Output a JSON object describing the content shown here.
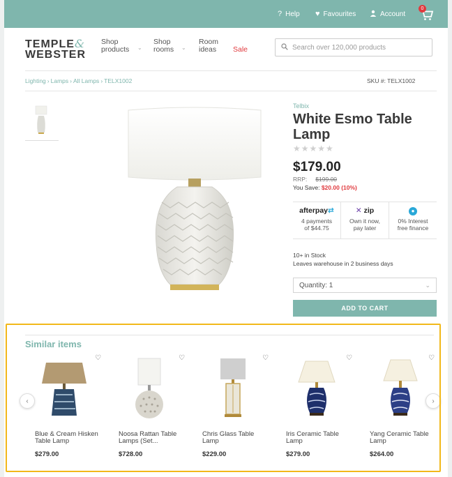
{
  "topbar": {
    "help": "Help",
    "favourites": "Favourites",
    "account": "Account",
    "cart_count": "0",
    "color": "#7fb6ad"
  },
  "header": {
    "logo_line1": "TEMPLE",
    "logo_amp": "&",
    "logo_line2": "WEBSTER",
    "nav": [
      {
        "line1": "Shop",
        "line2": "products"
      },
      {
        "line1": "Shop",
        "line2": "rooms"
      },
      {
        "line1": "Room",
        "line2": "ideas"
      }
    ],
    "sale": "Sale",
    "search_placeholder": "Search over 120,000 products"
  },
  "breadcrumb": [
    "Lighting",
    "Lamps",
    "All Lamps",
    "TELX1002"
  ],
  "sku": "SKU #: TELX1002",
  "product": {
    "brand": "Telbix",
    "title": "White Esmo Table Lamp",
    "stars": "★★★★★",
    "rating": 0,
    "price": "$179.00",
    "rrp_label": "RRP:",
    "rrp_value": "$199.00",
    "save_label": "You Save:",
    "save_value": "$20.00 (10%)",
    "payments": [
      {
        "brand": "afterpay",
        "line1": "4 payments",
        "line2": "of $44.75"
      },
      {
        "brand": "zip",
        "line1": "Own it now,",
        "line2": "pay later"
      },
      {
        "brand": "",
        "line1": "0% Interest",
        "line2": "free finance"
      }
    ],
    "stock": "10+ in Stock",
    "dispatch": "Leaves warehouse in 2 business days",
    "quantity": "Quantity: 1",
    "add_to_cart": "ADD TO CART"
  },
  "similar": {
    "title": "Similar items",
    "items": [
      {
        "name": "Blue & Cream Hisken Table Lamp",
        "price": "$279.00"
      },
      {
        "name": "Noosa Rattan Table Lamps (Set...",
        "price": "$728.00"
      },
      {
        "name": "Chris Glass Table Lamp",
        "price": "$229.00"
      },
      {
        "name": "Iris Ceramic Table Lamp",
        "price": "$279.00"
      },
      {
        "name": "Yang Ceramic Table Lamp",
        "price": "$264.00"
      }
    ]
  },
  "colors": {
    "accent": "#7fb6ad",
    "sale": "#e03a3e",
    "highlight_border": "#f2b81a"
  }
}
